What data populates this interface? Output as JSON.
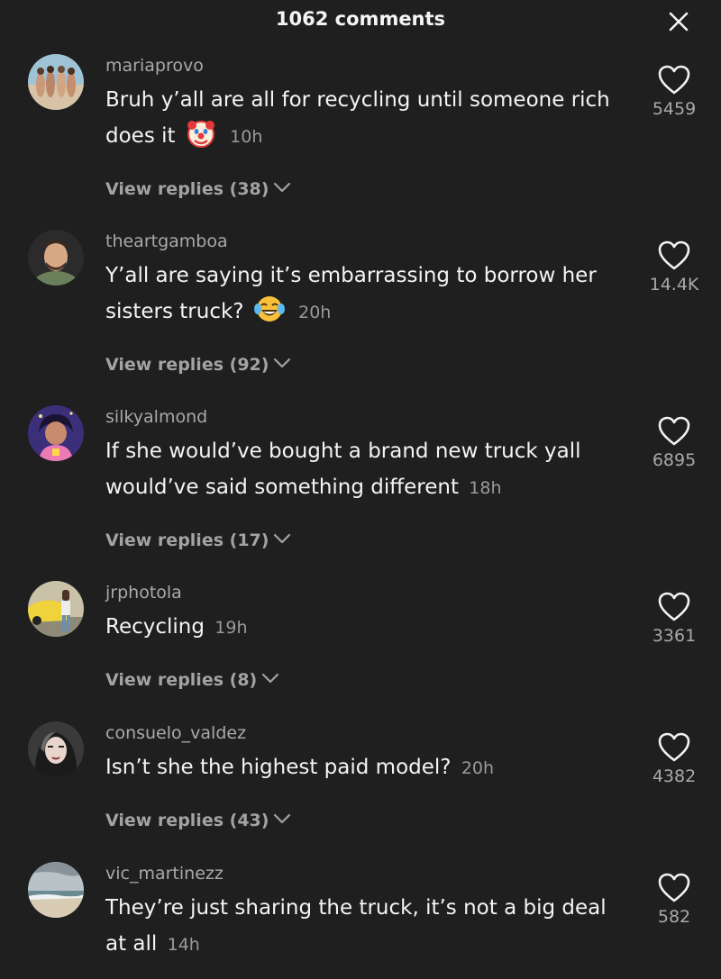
{
  "header": {
    "title": "1062 comments"
  },
  "comments": [
    {
      "username": "mariaprovo",
      "text": "Bruh y’all are all for recycling until someone rich does it",
      "emoji": "clown-face-emoji",
      "time": "10h",
      "replies": "View replies (38)",
      "likes": "5459"
    },
    {
      "username": "theartgamboa",
      "text": "Y’all are saying it’s embarrassing to borrow her sisters truck?",
      "emoji": "tears-of-joy-emoji",
      "time": "20h",
      "replies": "View replies (92)",
      "likes": "14.4K"
    },
    {
      "username": "silkyalmond",
      "text": "If she would’ve bought a brand new truck yall would’ve said something different",
      "time": "18h",
      "replies": "View replies (17)",
      "likes": "6895"
    },
    {
      "username": "jrphotola",
      "text": "Recycling",
      "time": "19h",
      "replies": "View replies (8)",
      "likes": "3361"
    },
    {
      "username": "consuelo_valdez",
      "text": "Isn’t she the highest paid model?",
      "time": "20h",
      "replies": "View replies (43)",
      "likes": "4382"
    },
    {
      "username": "vic_martinezz",
      "text": "They’re just sharing the truck, it’s not a big deal at all",
      "time": "14h",
      "likes": "582"
    }
  ],
  "icons": {
    "close": "close-icon",
    "like": "heart-icon",
    "expand": "chevron-down-icon"
  },
  "colors": {
    "background": "#1f1f1f",
    "primary_text": "#f4f4f4",
    "secondary_text": "#a9a9a9"
  }
}
